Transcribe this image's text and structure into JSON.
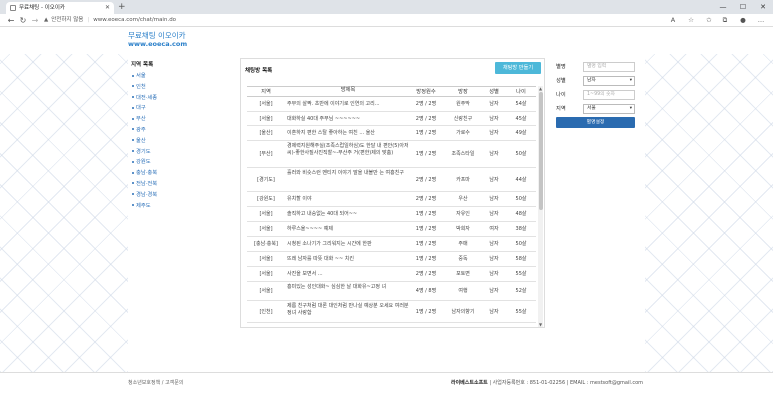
{
  "browser": {
    "tab_title": "무료채팅 - 이오이카",
    "new_tab": "+",
    "warn_text": "안전하지 않음",
    "url": "www.eoeca.com/chat/main.do"
  },
  "header": {
    "logo_line1": "무료채팅 이오이카",
    "logo_line2": "www.eoeca.com"
  },
  "sidebar": {
    "title": "지역 목록",
    "items": [
      "서울",
      "인천",
      "대전·세종",
      "대구",
      "부산",
      "광주",
      "울산",
      "경기도",
      "강원도",
      "충남·충북",
      "전남·전북",
      "경남·경북",
      "제주도"
    ]
  },
  "main": {
    "title": "채팅방 목록",
    "create_button": "채팅방 만들기",
    "headers": {
      "region": "지역",
      "title": "방제목",
      "count": "방정원수",
      "tendency": "방장",
      "gender": "성별",
      "age": "나이"
    },
    "rows": [
      {
        "region": "[서울]",
        "title": "주부의 살짝. 초반에 이야기로 인연의 고리...",
        "count": "2명 / 2명",
        "tendency": "원주막",
        "gender": "남자",
        "age": "54살"
      },
      {
        "region": "[서울]",
        "title": "대화하실 40대 주부님 ~~~~~~",
        "count": "2명 / 2명",
        "tendency": "신랑친구",
        "gender": "남자",
        "age": "45살"
      },
      {
        "region": "[울산]",
        "title": "이혼하지 편한 스탈 좋아하는 여친 ... 울산",
        "count": "1명 / 2명",
        "tendency": "가로수",
        "gender": "남자",
        "age": "49살"
      },
      {
        "region": "[부산]",
        "title": "경제력지원해주실(조족스럽일하심)도 한달 내 편안(5)아저씨)-좋한사질사진직찰~-부산주 거(편한)제의 맞춤)",
        "count": "1명 / 2명",
        "tendency": "조족스타일",
        "gender": "남자",
        "age": "50살"
      },
      {
        "region": "[경기도]",
        "title": "흘러와 비슷스런 멘티지 이야기 말을 내볼만 는 여흥친구",
        "count": "2명 / 2명",
        "tendency": "카프마",
        "gender": "남자",
        "age": "44살"
      },
      {
        "region": "[강원도]",
        "title": "유치할 이야",
        "count": "2명 / 2명",
        "tendency": "우산",
        "gender": "남자",
        "age": "50살"
      },
      {
        "region": "[서울]",
        "title": "솔직하고 내숭없는 40대 되어~~",
        "count": "1명 / 2명",
        "tendency": "자유인",
        "gender": "남자",
        "age": "48살"
      },
      {
        "region": "[서울]",
        "title": "하루스울~~~~ 예제",
        "count": "1명 / 2명",
        "tendency": "박희자",
        "gender": "여자",
        "age": "38살"
      },
      {
        "region": "[충남·충북]",
        "title": "시청된 소나기가 그리워지는 시간에 한판",
        "count": "1명 / 2명",
        "tendency": "주매",
        "gender": "남자",
        "age": "50살"
      },
      {
        "region": "[서울]",
        "title": "뜨레 남자를 따뜻 대화 ~~ 치킨",
        "count": "1명 / 2명",
        "tendency": "중독",
        "gender": "남자",
        "age": "58살"
      },
      {
        "region": "[서울]",
        "title": "사진을 보면서 ...",
        "count": "2명 / 2명",
        "tendency": "포토면",
        "gender": "남자",
        "age": "55살"
      },
      {
        "region": "[서울]",
        "title": "흥미있는 성인대화~ 심심한 날 대화유~고정 녀",
        "count": "4명 / 8명",
        "tendency": "여행",
        "gender": "남자",
        "age": "52살"
      },
      {
        "region": "[인천]",
        "title": "제름 친구처럼 대론 대인처럼 만나실 예상분 오세요 여러분 정녀 사랑함",
        "count": "1명 / 2명",
        "tendency": "남자의향기",
        "gender": "남자",
        "age": "55살"
      }
    ]
  },
  "form": {
    "name_label": "별명",
    "name_placeholder": "별명 입력",
    "gender_label": "성별",
    "gender_value": "남자",
    "age_label": "나이",
    "age_placeholder": "1~99의 숫자",
    "region_label": "지역",
    "region_value": "서울",
    "save_button": "별명설정"
  },
  "footer": {
    "left": "청소년보호정책 / 고객문의",
    "company": "라이베스트소프트",
    "right": "| 사업자등록번호 : 851-01-02256 | EMAIL : mestsoft@gmail.com"
  }
}
